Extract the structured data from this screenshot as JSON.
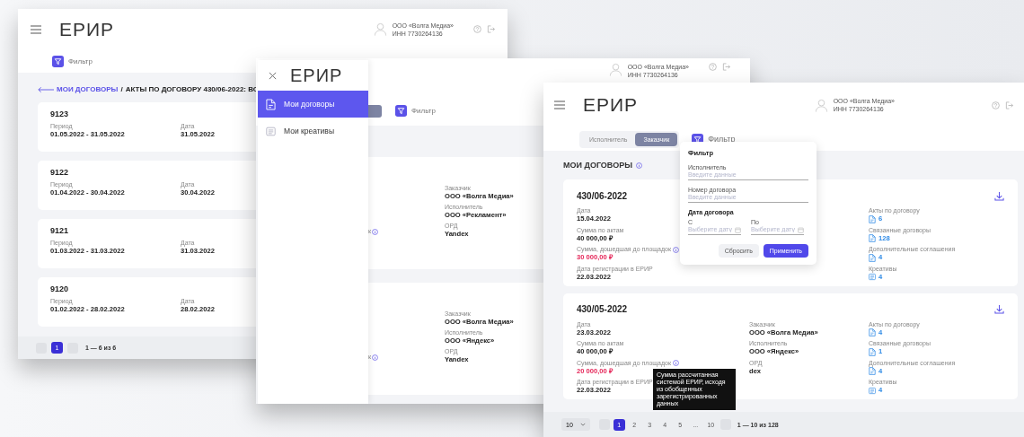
{
  "acts_window": {
    "header": {
      "logo": "ЕРИР",
      "user_name": "ООО «Волга Медиа»",
      "user_inn": "ИНН 7730264136"
    },
    "filter_label": "Фильтр",
    "breadcrumb": {
      "link": "МОИ ДОГОВОРЫ",
      "separator": "/",
      "current": "АКТЫ ПО ДОГОВОРУ 430/06-2022: ВС"
    },
    "acts": [
      {
        "number": "9123",
        "fields": [
          {
            "label": "Период",
            "value": "01.05.2022 - 31.05.2022"
          },
          {
            "label": "Дата",
            "value": "31.05.2022"
          }
        ]
      },
      {
        "number": "9122",
        "fields": [
          {
            "label": "Период",
            "value": "01.04.2022 - 30.04.2022"
          },
          {
            "label": "Дата",
            "value": "30.04.2022"
          }
        ]
      },
      {
        "number": "9121",
        "fields": [
          {
            "label": "Период",
            "value": "01.03.2022 - 31.03.2022"
          },
          {
            "label": "Дата",
            "value": "31.03.2022"
          }
        ]
      },
      {
        "number": "9120",
        "fields": [
          {
            "label": "Период",
            "value": "01.02.2022 - 28.02.2022"
          },
          {
            "label": "Дата",
            "value": "28.02.2022"
          }
        ]
      }
    ],
    "pagination": {
      "pages": [
        {
          "label": "1",
          "selected": true
        }
      ],
      "summary": "1 — 6 из 6"
    }
  },
  "drawer_window": {
    "header": {
      "user_name": "ООО «Волга Медиа»",
      "user_inn": "ИНН 7730264136"
    },
    "filter_label": "Фильтр",
    "contracts": [
      {
        "hint_fragment": "к",
        "fields": [
          {
            "label": "Заказчик",
            "value": "ООО «Волга Медиа»"
          },
          {
            "label": "Исполнитель",
            "value": "ООО «Рекламент»"
          },
          {
            "label": "ОРД",
            "value": "Yandex"
          }
        ]
      },
      {
        "hint_fragment": "к",
        "fields": [
          {
            "label": "Заказчик",
            "value": "ООО «Волга Медиа»"
          },
          {
            "label": "Исполнитель",
            "value": "ООО «Яндекс»"
          },
          {
            "label": "ОРД",
            "value": "Yandex"
          }
        ]
      }
    ],
    "drawer": {
      "logo": "ЕРИР",
      "items": [
        {
          "label": "Мои договоры",
          "kind": "document",
          "selected": true
        },
        {
          "label": "Мои креативы",
          "kind": "creative",
          "selected": false
        }
      ]
    }
  },
  "contracts_window": {
    "header": {
      "logo": "ЕРИР",
      "user_name": "ООО «Волга Медиа»",
      "user_inn": "ИНН 7730264136"
    },
    "roles": [
      {
        "label": "Исполнитель",
        "selected": false
      },
      {
        "label": "Заказчик",
        "selected": true
      }
    ],
    "filter_label": "Фильтр",
    "filter_popup": {
      "title": "Фильтр",
      "fields": [
        {
          "label": "Исполнитель",
          "placeholder": "Введите данные"
        },
        {
          "label": "Номер договора",
          "placeholder": "Введите данные"
        }
      ],
      "date_group": {
        "title": "Дата договора",
        "fields": [
          {
            "label": "С",
            "placeholder": "Выберите дату"
          },
          {
            "label": "По",
            "placeholder": "Выберите дату"
          }
        ]
      },
      "buttons": [
        {
          "label": "Сбросить",
          "kind": "secondary"
        },
        {
          "label": "Применить",
          "kind": "primary"
        }
      ]
    },
    "section_title": "МОИ ДОГОВОРЫ",
    "contracts": [
      {
        "number": "430/06-2022",
        "details": [
          {
            "label": "Дата",
            "value": "15.04.2022",
            "highlight": false,
            "info": false
          },
          {
            "label": "Сумма по актам",
            "value": "40 000,00 ₽",
            "highlight": false,
            "info": false
          },
          {
            "label": "Сумма, дошедшая до площадок",
            "value": "30 000,00 ₽",
            "highlight": true,
            "info": true
          },
          {
            "label": "Дата регистрации в ЕРИР",
            "value": "22.03.2022",
            "highlight": false,
            "info": false
          }
        ],
        "documents": [
          {
            "label": "Акты по договору",
            "count": "6",
            "kind": "document"
          },
          {
            "label": "Связанные договоры",
            "count": "128",
            "kind": "document"
          },
          {
            "label": "Дополнительные соглашения",
            "count": "4",
            "kind": "document"
          },
          {
            "label": "Креативы",
            "count": "4",
            "kind": "creative"
          }
        ]
      },
      {
        "number": "430/05-2022",
        "details": [
          {
            "label": "Дата",
            "value": "23.03.2022",
            "highlight": false,
            "info": false
          },
          {
            "label": "Сумма по актам",
            "value": "40 000,00 ₽",
            "highlight": false,
            "info": false
          },
          {
            "label": "Сумма, дошедшая до площадок",
            "value": "20 000,00 ₽",
            "highlight": true,
            "info": true,
            "tooltip": "Сумма рассчитанная системой ЕРИР, исходя из обобщенных зарегистрированных данных"
          },
          {
            "label": "Дата регистрации в ЕРИР",
            "value": "22.03.2022",
            "highlight": false,
            "info": false
          }
        ],
        "parties": [
          {
            "label": "Заказчик",
            "value": "ООО «Волга Медиа»"
          },
          {
            "label": "Исполнитель",
            "value": "ООО «Яндекс»"
          },
          {
            "label": "ОРД",
            "value": "dex"
          }
        ],
        "documents": [
          {
            "label": "Акты по договору",
            "count": "4",
            "kind": "document"
          },
          {
            "label": "Связанные договоры",
            "count": "1",
            "kind": "document"
          },
          {
            "label": "Дополнительные соглашения",
            "count": "4",
            "kind": "document"
          },
          {
            "label": "Креативы",
            "count": "4",
            "kind": "creative"
          }
        ]
      }
    ],
    "pagination": {
      "page_size": "10",
      "pages": [
        {
          "label": "1",
          "selected": true
        },
        {
          "label": "2",
          "selected": false
        },
        {
          "label": "3",
          "selected": false
        },
        {
          "label": "4",
          "selected": false
        },
        {
          "label": "5",
          "selected": false
        },
        {
          "label": "...",
          "selected": false
        },
        {
          "label": "10",
          "selected": false
        }
      ],
      "summary": "1 — 10 из 128"
    }
  }
}
